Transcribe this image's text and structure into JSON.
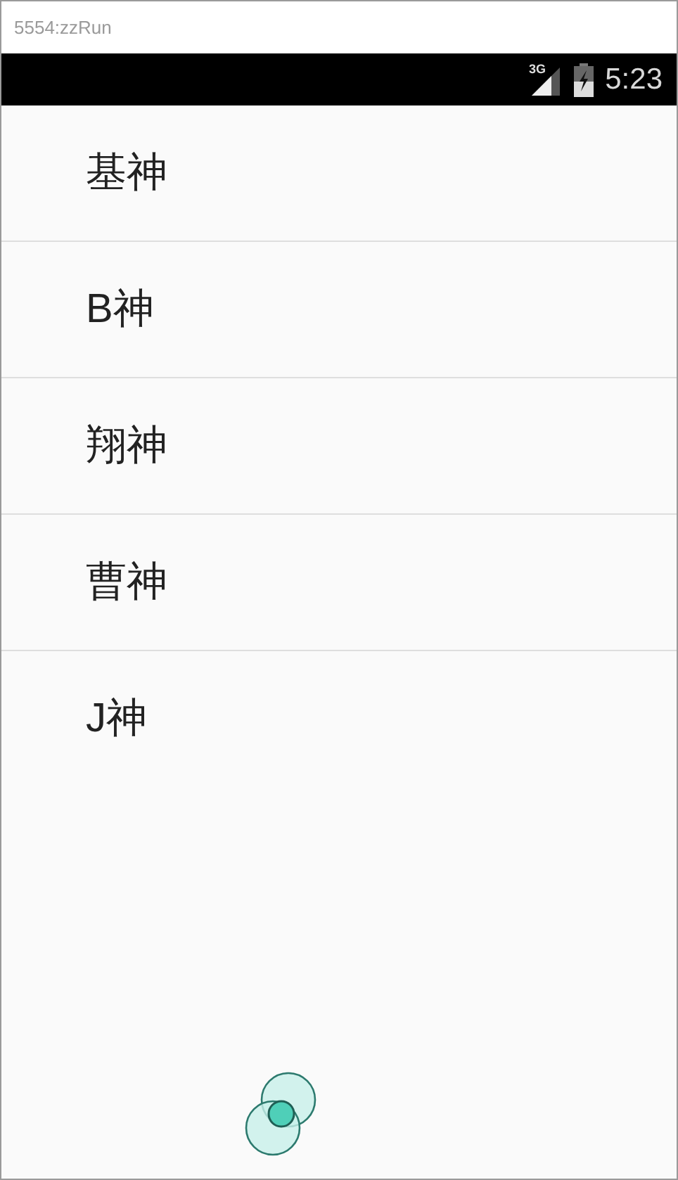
{
  "window": {
    "title": "5554:zzRun"
  },
  "status_bar": {
    "time": "5:23",
    "network": "3G"
  },
  "list": {
    "items": [
      {
        "label": "基神"
      },
      {
        "label": "B神"
      },
      {
        "label": "翔神"
      },
      {
        "label": "曹神"
      },
      {
        "label": "J神"
      }
    ]
  }
}
